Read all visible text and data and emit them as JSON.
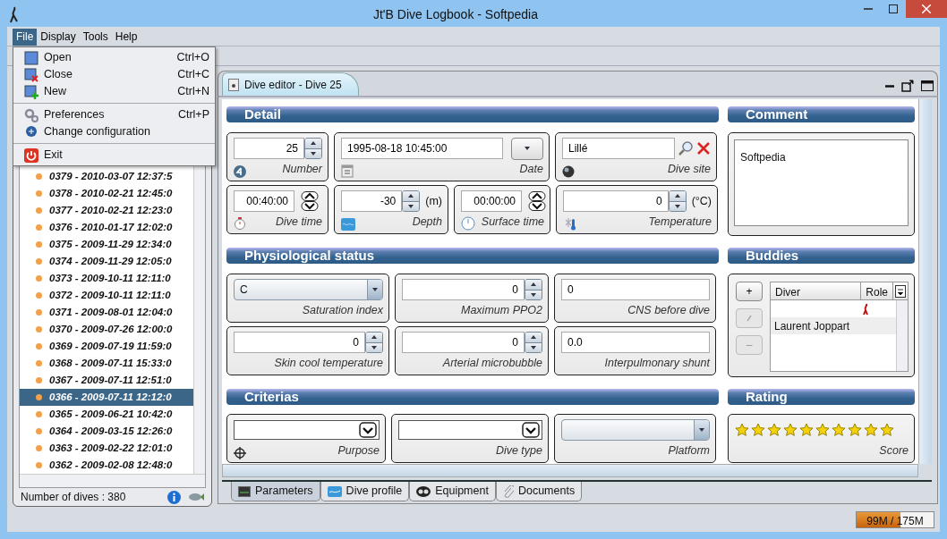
{
  "window": {
    "title": "Jt'B Dive Logbook - Softpedia"
  },
  "menubar": [
    {
      "label": "File",
      "selected": true
    },
    {
      "label": "Display",
      "selected": false
    },
    {
      "label": "Tools",
      "selected": false
    },
    {
      "label": "Help",
      "selected": false
    }
  ],
  "file_menu": {
    "groups": [
      [
        {
          "label": "Open",
          "shortcut": "Ctrl+O"
        },
        {
          "label": "Close",
          "shortcut": "Ctrl+C"
        },
        {
          "label": "New",
          "shortcut": "Ctrl+N"
        }
      ],
      [
        {
          "label": "Preferences",
          "shortcut": "Ctrl+P"
        },
        {
          "label": "Change configuration"
        }
      ],
      [
        {
          "label": "Exit"
        }
      ]
    ]
  },
  "dive_list": {
    "items": [
      {
        "label": "0379 - 2010-03-07 12:37:5",
        "selected": false
      },
      {
        "label": "0378 - 2010-02-21 12:45:0",
        "selected": false
      },
      {
        "label": "0377 - 2010-02-21 12:23:0",
        "selected": false
      },
      {
        "label": "0376 - 2010-01-17 12:02:0",
        "selected": false
      },
      {
        "label": "0375 - 2009-11-29 12:34:0",
        "selected": false
      },
      {
        "label": "0374 - 2009-11-29 12:05:0",
        "selected": false
      },
      {
        "label": "0373 - 2009-10-11 12:11:0",
        "selected": false
      },
      {
        "label": "0372 - 2009-10-11 12:11:0",
        "selected": false
      },
      {
        "label": "0371 - 2009-08-01 12:04:0",
        "selected": false
      },
      {
        "label": "0370 - 2009-07-26 12:00:0",
        "selected": false
      },
      {
        "label": "0369 - 2009-07-19 11:59:0",
        "selected": false
      },
      {
        "label": "0368 - 2009-07-11 15:33:0",
        "selected": false
      },
      {
        "label": "0367 - 2009-07-11 12:51:0",
        "selected": false
      },
      {
        "label": "0366 - 2009-07-11 12:12:0",
        "selected": true
      },
      {
        "label": "0365 - 2009-06-21 10:42:0",
        "selected": false
      },
      {
        "label": "0364 - 2009-03-15 12:26:0",
        "selected": false
      },
      {
        "label": "0363 - 2009-02-22 12:01:0",
        "selected": false
      },
      {
        "label": "0362 - 2009-02-08 12:48:0",
        "selected": false
      }
    ],
    "footer": "Number of dives : 380"
  },
  "editor": {
    "tab": "Dive editor - Dive 25",
    "detail": {
      "title": "Detail",
      "rows": [
        {
          "fields": [
            {
              "kind": "spinner",
              "value": "25",
              "label": "Number"
            },
            {
              "kind": "date",
              "value": "1995-08-18 10:45:00",
              "label": "Date"
            },
            {
              "kind": "site",
              "value": "Lillé",
              "label": "Dive site"
            }
          ]
        },
        {
          "fields": [
            {
              "kind": "time",
              "value": "00:40:00",
              "label": "Dive time"
            },
            {
              "kind": "spinner",
              "value": "-30",
              "unit": "(m)",
              "label": "Depth"
            },
            {
              "kind": "time",
              "value": "00:00:00",
              "label": "Surface time"
            },
            {
              "kind": "spinner",
              "value": "0",
              "unit": "(°C)",
              "label": "Temperature"
            }
          ]
        }
      ]
    },
    "comment": {
      "title": "Comment",
      "text": "Softpedia"
    },
    "physiological": {
      "title": "Physiological status",
      "rows": [
        {
          "fields": [
            {
              "kind": "combo",
              "value": "C",
              "label": "Saturation index"
            },
            {
              "kind": "spinner",
              "value": "0",
              "label": "Maximum PPO2"
            },
            {
              "kind": "text",
              "value": "0",
              "label": "CNS before dive"
            }
          ]
        },
        {
          "fields": [
            {
              "kind": "spinner",
              "value": "0",
              "label": "Skin cool temperature"
            },
            {
              "kind": "spinner",
              "value": "0",
              "label": "Arterial microbubble"
            },
            {
              "kind": "text",
              "value": "0.0",
              "label": "Interpulmonary shunt"
            }
          ]
        }
      ]
    },
    "buddies": {
      "title": "Buddies",
      "buttons": [
        {
          "kind": "add",
          "label": "+",
          "disabled": false
        },
        {
          "kind": "edit",
          "disabled": true
        },
        {
          "kind": "remove",
          "label": "–",
          "disabled": true
        }
      ],
      "columns": [
        "Diver",
        "Role"
      ],
      "rows": [
        {
          "kind": "role"
        },
        {
          "kind": "buddy",
          "diver": "Laurent Joppart"
        }
      ]
    },
    "criterias": {
      "title": "Criterias",
      "rows": [
        {
          "fields": [
            {
              "kind": "editable-combo",
              "label": "Purpose"
            },
            {
              "kind": "editable-combo",
              "label": "Dive type"
            },
            {
              "kind": "combo",
              "label": "Platform"
            }
          ]
        }
      ]
    },
    "rating": {
      "title": "Rating",
      "stars": 10,
      "label": "Score"
    },
    "bottom_tabs": [
      {
        "label": "Parameters",
        "selected": true
      },
      {
        "label": "Dive profile",
        "selected": false
      },
      {
        "label": "Equipment",
        "selected": false
      },
      {
        "label": "Documents",
        "selected": false
      }
    ]
  },
  "status_bar": {
    "memory": {
      "level": 0.57,
      "reading": "99M / 175M"
    }
  }
}
